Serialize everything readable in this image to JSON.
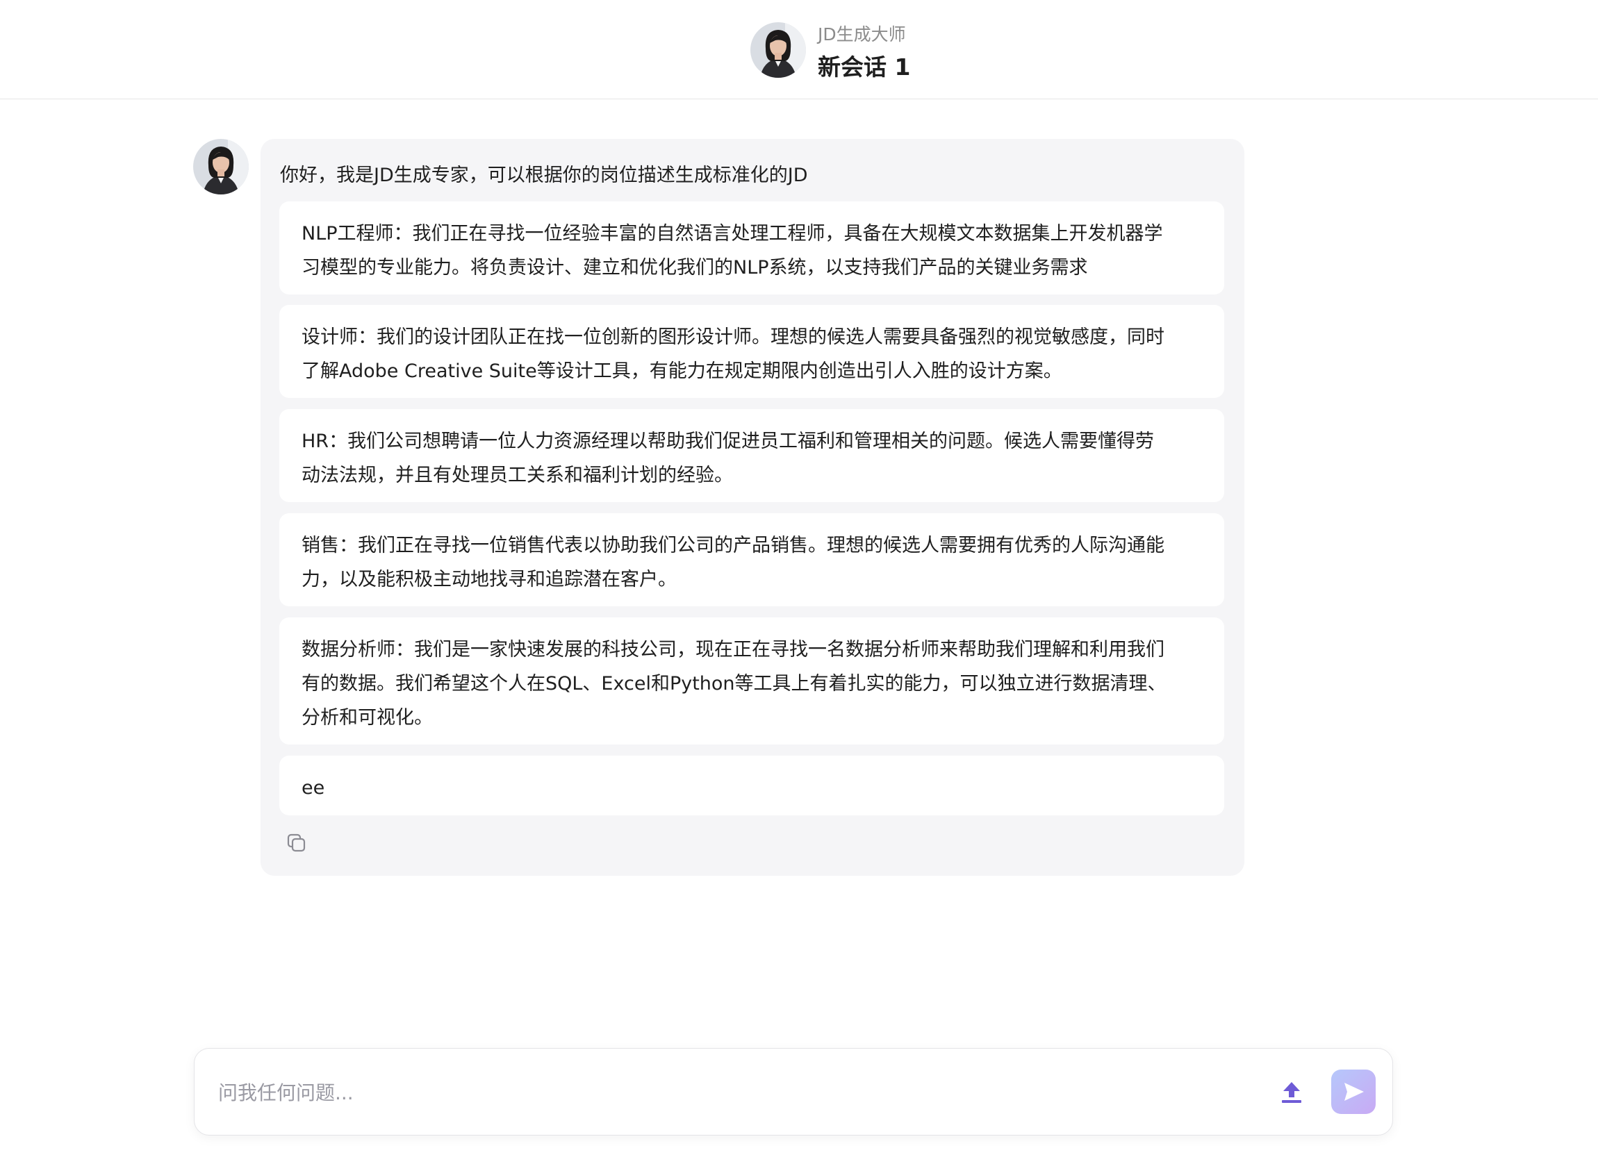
{
  "header": {
    "subtitle": "JD生成大师",
    "title": "新会话 1",
    "avatar_icon": "avatar-woman-icon"
  },
  "message": {
    "avatar_icon": "avatar-woman-icon",
    "greeting": "你好，我是JD生成专家，可以根据你的岗位描述生成标准化的JD",
    "suggestions": [
      {
        "line1": "NLP工程师：我们正在寻找一位经验丰富的自然语言处理工程师，具备在大规模文本数据集上开发机器学",
        "line2": "习模型的专业能力。将负责设计、建立和优化我们的NLP系统，以支持我们产品的关键业务需求",
        "line3": ""
      },
      {
        "line1": "设计师：我们的设计团队正在找一位创新的图形设计师。理想的候选人需要具备强烈的视觉敏感度，同时",
        "line2": "了解Adobe Creative Suite等设计工具，有能力在规定期限内创造出引人入胜的设计方案。",
        "line3": ""
      },
      {
        "line1": "HR：我们公司想聘请一位人力资源经理以帮助我们促进员工福利和管理相关的问题。候选人需要懂得劳",
        "line2": "动法法规，并且有处理员工关系和福利计划的经验。",
        "line3": ""
      },
      {
        "line1": "销售：我们正在寻找一位销售代表以协助我们公司的产品销售。理想的候选人需要拥有优秀的人际沟通能",
        "line2": "力，以及能积极主动地找寻和追踪潜在客户。",
        "line3": ""
      },
      {
        "line1": "数据分析师：我们是一家快速发展的科技公司，现在正在寻找一名数据分析师来帮助我们理解和利用我们",
        "line2": "有的数据。我们希望这个人在SQL、Excel和Python等工具上有着扎实的能力，可以独立进行数据清理、",
        "line3": "分析和可视化。"
      },
      {
        "line1": "ee",
        "line2": "",
        "line3": ""
      }
    ],
    "copy_icon": "copy-icon"
  },
  "input": {
    "placeholder": "问我任何问题...",
    "value": "",
    "upload_icon": "upload-icon",
    "send_icon": "send-icon"
  },
  "colors": {
    "bubble_bg": "#f5f5f7",
    "accent_purple": "#6e5bd6",
    "send_gradient_start": "#b6c8fb",
    "send_gradient_end": "#c8aaf4"
  }
}
